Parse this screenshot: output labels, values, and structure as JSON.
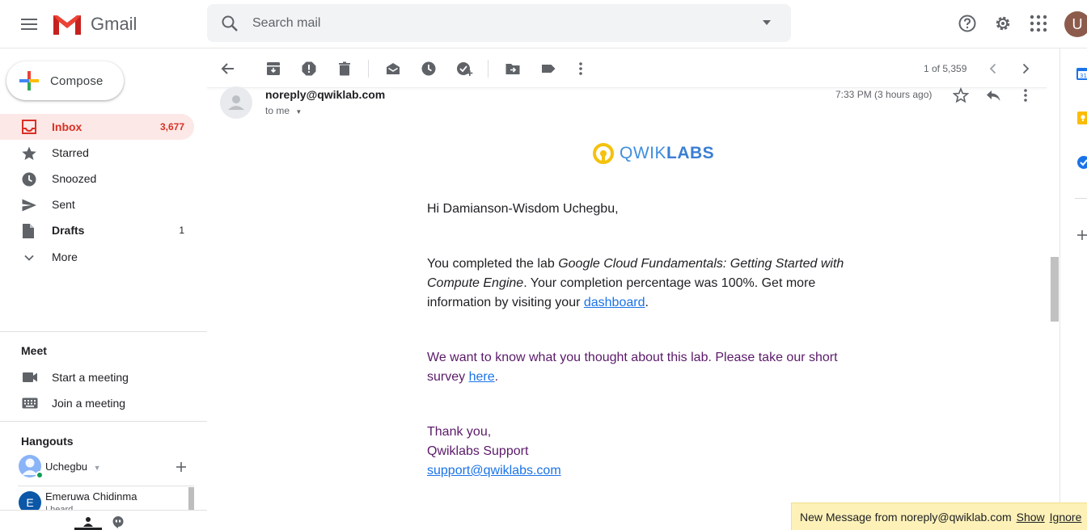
{
  "header": {
    "app_name": "Gmail",
    "search_placeholder": "Search mail",
    "avatar_letter": "U"
  },
  "compose": {
    "label": "Compose"
  },
  "nav": [
    {
      "label": "Inbox",
      "count": "3,677",
      "icon": "inbox-icon"
    },
    {
      "label": "Starred",
      "count": "",
      "icon": "star-icon"
    },
    {
      "label": "Snoozed",
      "count": "",
      "icon": "clock-icon"
    },
    {
      "label": "Sent",
      "count": "",
      "icon": "send-icon"
    },
    {
      "label": "Drafts",
      "count": "1",
      "icon": "draft-icon"
    },
    {
      "label": "More",
      "count": "",
      "icon": "chevron-down-icon"
    }
  ],
  "meet": {
    "title": "Meet",
    "items": [
      {
        "label": "Start a meeting",
        "icon": "video-icon"
      },
      {
        "label": "Join a meeting",
        "icon": "keyboard-icon"
      }
    ]
  },
  "hangouts": {
    "title": "Hangouts",
    "user_name": "Uchegbu",
    "contact": {
      "initial": "E",
      "name": "Emeruwa Chidinma",
      "status": "I heard"
    }
  },
  "toolbar": {
    "pager": "1 of 5,359"
  },
  "message": {
    "sender": "noreply@qwiklab.com",
    "to": "to me",
    "time": "7:33 PM (3 hours ago)",
    "brand_light": "QWIK",
    "brand_bold": "LABS",
    "greeting": "Hi Damianson-Wisdom Uchegbu,",
    "p1_a": "You completed the lab ",
    "p1_lab": "Google Cloud Fundamentals: Getting Started with Compute Engine",
    "p1_b": ". Your completion percentage was 100%. Get more information by visiting your ",
    "p1_link": "dashboard",
    "p1_c": ".",
    "p2_a": "We want to know what you thought about this lab. Please take our short survey ",
    "p2_link": "here",
    "p2_b": ".",
    "sign1": "Thank you,",
    "sign2": "Qwiklabs Support",
    "sign_email": "support@qwiklabs.com"
  },
  "notification": {
    "text": "New Message from noreply@qwiklab.com",
    "show": "Show",
    "ignore": "Ignore"
  },
  "colors": {
    "accent_red": "#d93025",
    "inbox_bg": "#fce8e6",
    "link_blue": "#1a73e8",
    "purple_text": "#5b1a6a",
    "notif_bg": "#fdf1b8"
  }
}
